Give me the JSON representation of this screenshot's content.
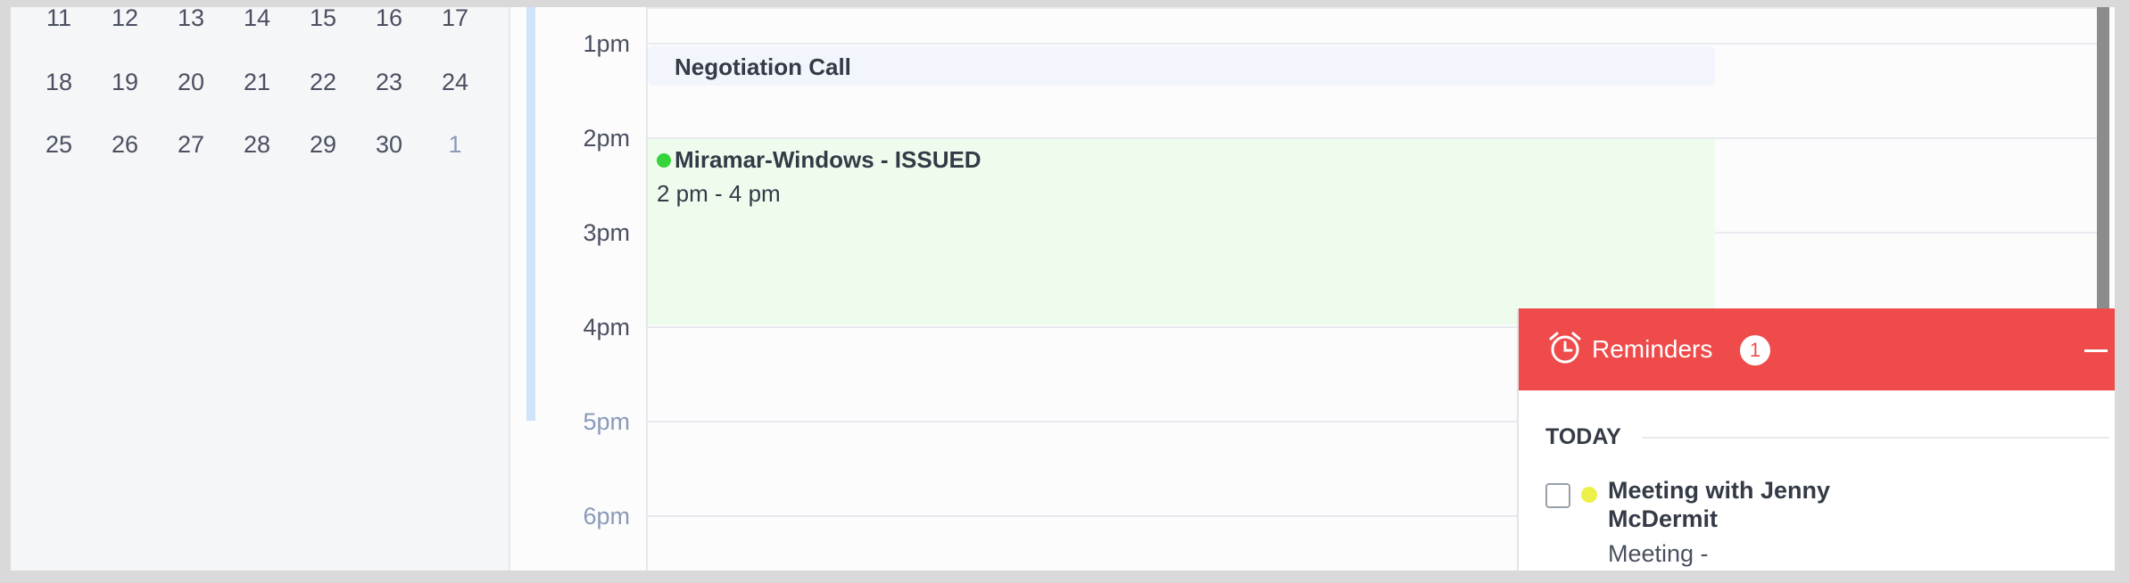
{
  "mini_calendar": {
    "rows": [
      [
        {
          "d": "11",
          "m": false
        },
        {
          "d": "12",
          "m": false
        },
        {
          "d": "13",
          "m": false
        },
        {
          "d": "14",
          "m": false
        },
        {
          "d": "15",
          "m": false
        },
        {
          "d": "16",
          "m": false
        },
        {
          "d": "17",
          "m": false
        }
      ],
      [
        {
          "d": "18",
          "m": false
        },
        {
          "d": "19",
          "m": false
        },
        {
          "d": "20",
          "m": false
        },
        {
          "d": "21",
          "m": false
        },
        {
          "d": "22",
          "m": false
        },
        {
          "d": "23",
          "m": false
        },
        {
          "d": "24",
          "m": false
        }
      ],
      [
        {
          "d": "25",
          "m": false
        },
        {
          "d": "26",
          "m": false
        },
        {
          "d": "27",
          "m": false
        },
        {
          "d": "28",
          "m": false
        },
        {
          "d": "29",
          "m": false
        },
        {
          "d": "30",
          "m": false
        },
        {
          "d": "1",
          "m": true
        }
      ]
    ]
  },
  "times": [
    {
      "label": "1pm",
      "muted": false
    },
    {
      "label": "2pm",
      "muted": false
    },
    {
      "label": "3pm",
      "muted": false
    },
    {
      "label": "4pm",
      "muted": false
    },
    {
      "label": "5pm",
      "muted": true
    },
    {
      "label": "6pm",
      "muted": true
    }
  ],
  "events": {
    "negotiation": {
      "title": "Negotiation Call"
    },
    "miramar": {
      "title": "Miramar-Windows - ISSUED",
      "time": "2 pm - 4 pm"
    }
  },
  "reminders": {
    "title": "Reminders",
    "count": "1",
    "section": "TODAY",
    "item": {
      "title": "Meeting with Jenny McDermit",
      "subtitle": "Meeting -"
    }
  },
  "colors": {
    "accent": "#ef4b4b",
    "event_green": "#35d43a",
    "reminder_dot": "#eef04a"
  }
}
